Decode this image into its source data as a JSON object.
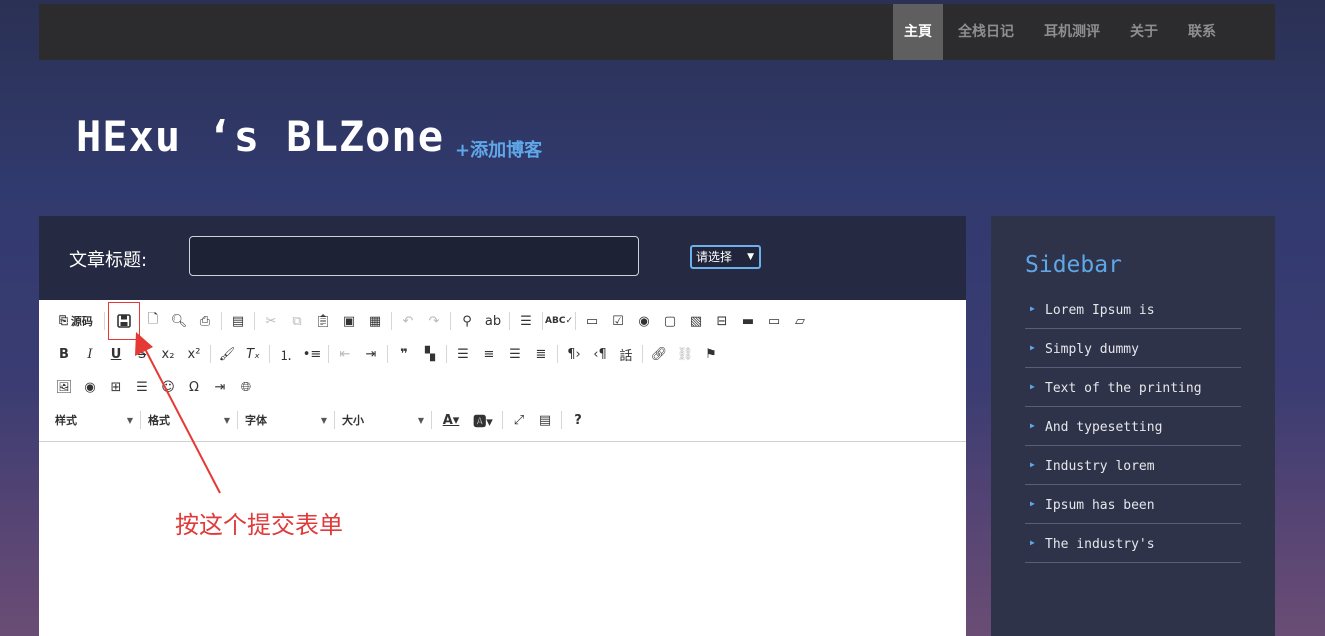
{
  "nav": {
    "items": [
      "主頁",
      "全栈日记",
      "耳机测评",
      "关于",
      "联系"
    ],
    "active_index": 0
  },
  "header": {
    "site_title": "HExu ‘s BLZone",
    "add_blog_link": "+添加博客"
  },
  "form": {
    "title_label": "文章标题:",
    "title_value": "",
    "category_select": "请选择"
  },
  "toolbar": {
    "source_label": "源码",
    "bold": "B",
    "italic": "I",
    "underline": "U",
    "strike": "S",
    "styles_label": "样式",
    "format_label": "格式",
    "font_label": "字体",
    "size_label": "大小",
    "help": "?"
  },
  "annotation": {
    "text": "按这个提交表单"
  },
  "sidebar": {
    "title": "Sidebar",
    "items": [
      "Lorem Ipsum is",
      "Simply dummy",
      "Text of the printing",
      "And typesetting",
      "Industry lorem",
      "Ipsum has been",
      "The industry's"
    ]
  },
  "colors": {
    "accent": "#5ea7e8",
    "annotation_red": "#e03a3a",
    "topbar": "#2c2c2e",
    "sidebar_bg": "#2e3349"
  }
}
